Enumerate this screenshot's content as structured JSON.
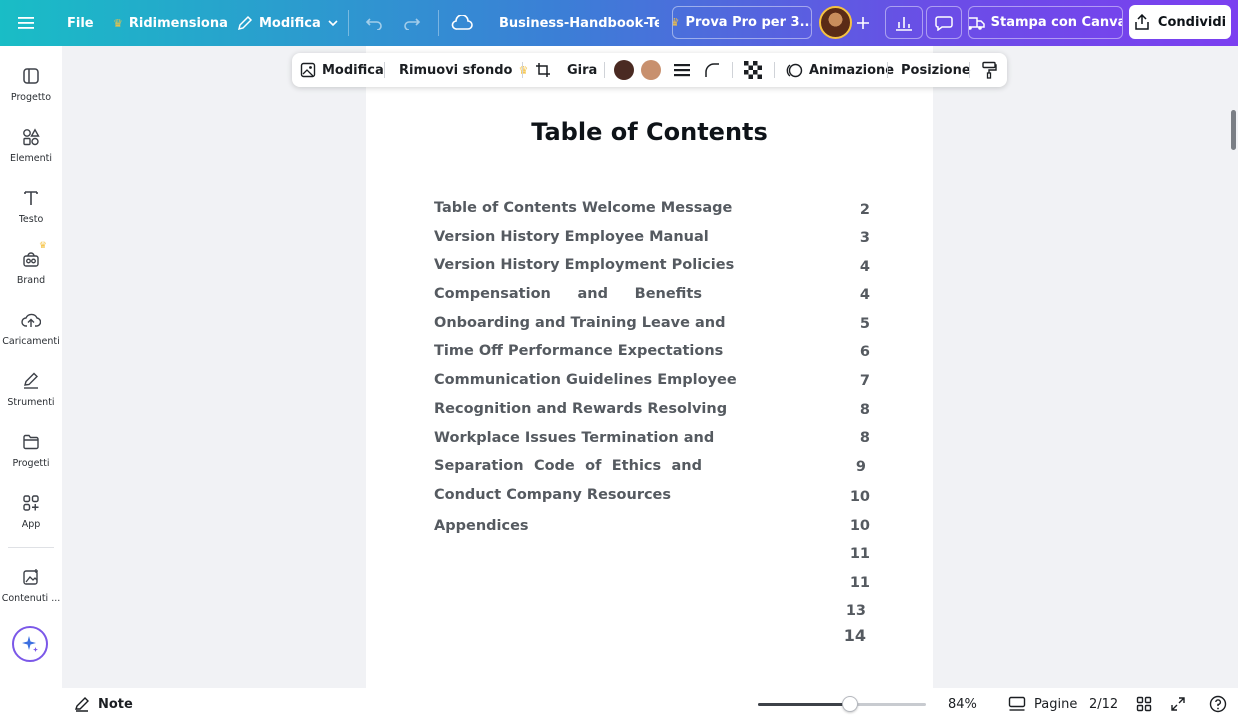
{
  "topbar": {
    "file_label": "File",
    "resize_label": "Ridimensiona",
    "edit_label": "Modifica",
    "doc_title": "Business-Handbook-Tem...",
    "pro_label": "Prova Pro per 3...",
    "print_label": "Stampa con Canva",
    "share_label": "Condividi"
  },
  "context_toolbar": {
    "edit_label": "Modifica",
    "remove_bg_label": "Rimuovi sfondo",
    "flip_label": "Gira",
    "color1": "#4a2a22",
    "color2": "#c8906e",
    "animation_label": "Animazione",
    "position_label": "Posizione"
  },
  "sidebar": {
    "items": [
      {
        "label": "Progetto",
        "icon": "layout-icon"
      },
      {
        "label": "Elementi",
        "icon": "shapes-icon"
      },
      {
        "label": "Testo",
        "icon": "text-icon"
      },
      {
        "label": "Brand",
        "icon": "brand-icon"
      },
      {
        "label": "Caricamenti",
        "icon": "upload-cloud-icon"
      },
      {
        "label": "Strumenti",
        "icon": "pen-tool-icon"
      },
      {
        "label": "Progetti",
        "icon": "folder-icon"
      },
      {
        "label": "App",
        "icon": "apps-grid-icon"
      },
      {
        "label": "Contenuti ...",
        "icon": "magic-media-icon"
      },
      {
        "label": "",
        "icon": "image-icon"
      }
    ]
  },
  "document": {
    "title": "Table of Contents",
    "lines": [
      "Table of Contents Welcome Message",
      "Version History Employee Manual",
      "Version History Employment Policies",
      "Compensation and Benefits",
      "Onboarding and Training Leave and",
      "Time Off Performance Expectations",
      "Communication Guidelines Employee",
      "Recognition and Rewards Resolving",
      "Workplace Issues Termination and",
      "Separation Code of Ethics and",
      "Conduct Company Resources",
      "Appendices"
    ],
    "page_numbers": [
      "2",
      "3",
      "4",
      "4",
      "5",
      "6",
      "7",
      "8",
      "8",
      "9",
      "10",
      "10",
      "11",
      "11",
      "13",
      "14"
    ]
  },
  "bottombar": {
    "notes_label": "Note",
    "zoom": "84%",
    "zoom_level": 0.55,
    "pages_label": "Pagine",
    "page_indicator": "2/12"
  }
}
